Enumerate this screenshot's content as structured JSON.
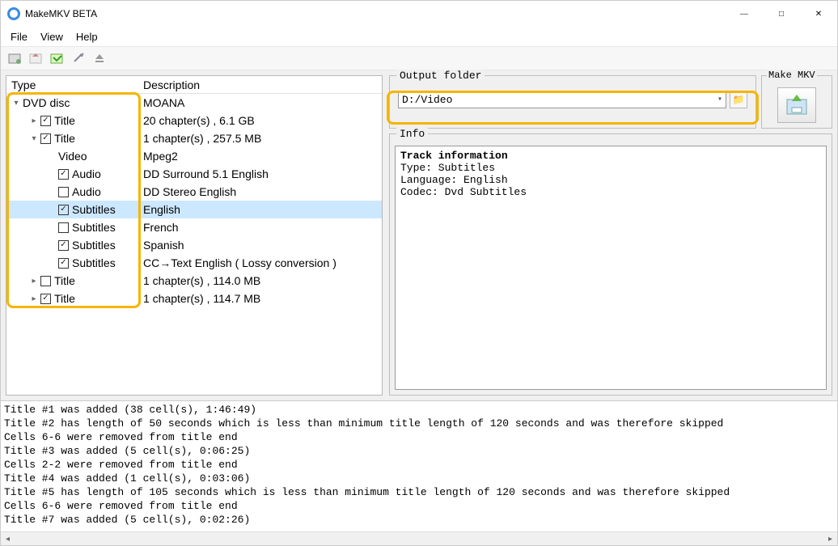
{
  "window": {
    "title": "MakeMKV BETA"
  },
  "menu": {
    "file": "File",
    "view": "View",
    "help": "Help"
  },
  "columns": {
    "type": "Type",
    "description": "Description"
  },
  "tree": [
    {
      "indent": 0,
      "expander": "down",
      "checkbox": null,
      "label": "DVD disc",
      "desc": "MOANA",
      "selected": false
    },
    {
      "indent": 1,
      "expander": "right",
      "checkbox": true,
      "label": "Title",
      "desc": "20 chapter(s) , 6.1 GB",
      "selected": false
    },
    {
      "indent": 1,
      "expander": "down",
      "checkbox": true,
      "label": "Title",
      "desc": "1 chapter(s) , 257.5 MB",
      "selected": false
    },
    {
      "indent": 2,
      "expander": null,
      "checkbox": null,
      "label": "Video",
      "desc": "Mpeg2",
      "selected": false
    },
    {
      "indent": 2,
      "expander": null,
      "checkbox": true,
      "label": "Audio",
      "desc": "DD Surround 5.1 English",
      "selected": false
    },
    {
      "indent": 2,
      "expander": null,
      "checkbox": false,
      "label": "Audio",
      "desc": "DD Stereo English",
      "selected": false
    },
    {
      "indent": 2,
      "expander": null,
      "checkbox": true,
      "label": "Subtitles",
      "desc": "English",
      "selected": true
    },
    {
      "indent": 2,
      "expander": null,
      "checkbox": false,
      "label": "Subtitles",
      "desc": "French",
      "selected": false
    },
    {
      "indent": 2,
      "expander": null,
      "checkbox": true,
      "label": "Subtitles",
      "desc": "Spanish",
      "selected": false
    },
    {
      "indent": 2,
      "expander": null,
      "checkbox": true,
      "label": "Subtitles",
      "desc": "CC→Text English ( Lossy conversion )",
      "selected": false
    },
    {
      "indent": 1,
      "expander": "right",
      "checkbox": false,
      "label": "Title",
      "desc": "1 chapter(s) , 114.0 MB",
      "selected": false
    },
    {
      "indent": 1,
      "expander": "right",
      "checkbox": true,
      "label": "Title",
      "desc": "1 chapter(s) , 114.7 MB",
      "selected": false
    }
  ],
  "output": {
    "legend": "Output folder",
    "value": "D:/Video"
  },
  "makemkv": {
    "legend": "Make MKV"
  },
  "info": {
    "legend": "Info",
    "heading": "Track information",
    "lines": [
      "Type: Subtitles",
      "Language: English",
      "Codec: Dvd Subtitles"
    ]
  },
  "log": [
    "Title #1 was added (38 cell(s), 1:46:49)",
    "Title #2 has length of 50 seconds which is less than minimum title length of 120 seconds and was therefore skipped",
    "Cells 6-6 were removed from title end",
    "Title #3 was added (5 cell(s), 0:06:25)",
    "Cells 2-2 were removed from title end",
    "Title #4 was added (1 cell(s), 0:03:06)",
    "Title #5 has length of 105 seconds which is less than minimum title length of 120 seconds and was therefore skipped",
    "Cells 6-6 were removed from title end",
    "Title #7 was added (5 cell(s), 0:02:26)"
  ]
}
